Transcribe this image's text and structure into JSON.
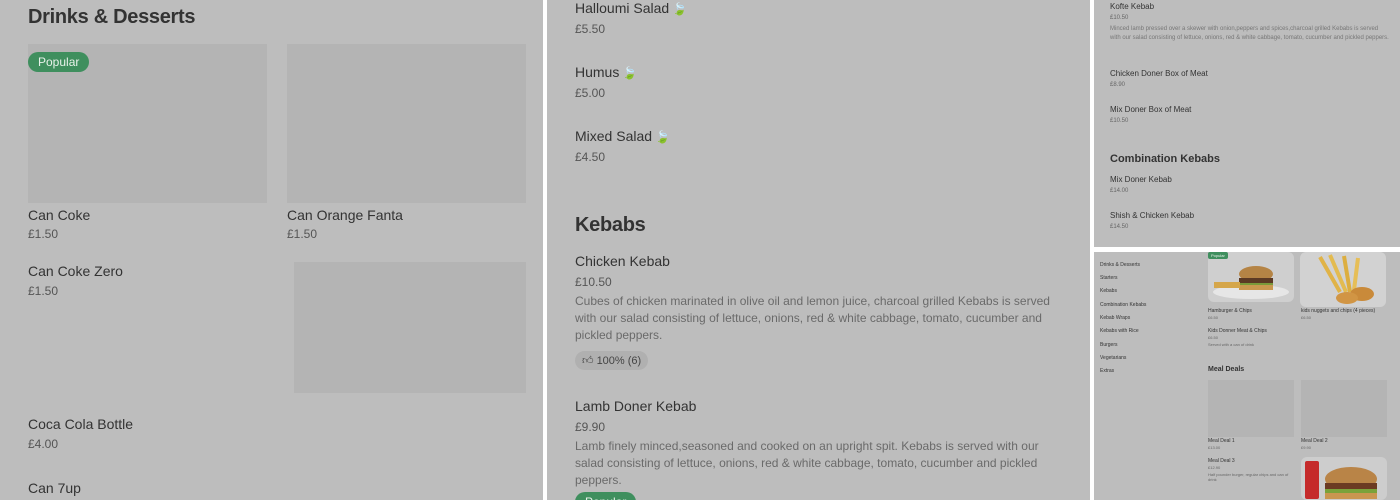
{
  "panel1": {
    "section_title": "Drinks & Desserts",
    "badge": "Popular",
    "items": [
      {
        "name": "Can Coke",
        "price": "£1.50"
      },
      {
        "name": "Can Orange Fanta",
        "price": "£1.50"
      },
      {
        "name": "Can Coke Zero",
        "price": "£1.50"
      },
      {
        "name": "Coca Cola Bottle",
        "price": "£4.00"
      },
      {
        "name": "Can 7up",
        "price": ""
      }
    ]
  },
  "panel2": {
    "salads": [
      {
        "name": "Halloumi Salad",
        "price": "£5.50"
      },
      {
        "name": "Humus",
        "price": "£5.00"
      },
      {
        "name": "Mixed Salad",
        "price": "£4.50"
      }
    ],
    "kebabs_title": "Kebabs",
    "kebabs": [
      {
        "name": "Chicken Kebab",
        "price": "£10.50",
        "desc": "Cubes of chicken marinated in olive oil and lemon juice, charcoal grilled Kebabs is served with our salad consisting of lettuce, onions, red & white cabbage, tomato, cucumber and pickled peppers.",
        "rating": "100% (6)"
      },
      {
        "name": "Lamb Doner Kebab",
        "price": "£9.90",
        "desc": "Lamb finely minced,seasoned and cooked on an upright spit. Kebabs is served with our salad consisting of lettuce, onions, red & white cabbage, tomato, cucumber and pickled peppers.",
        "badge": "Popular"
      }
    ]
  },
  "panel3": {
    "items": [
      {
        "name": "Kofte Kebab",
        "price": "£10.50",
        "desc": "Minced lamb pressed over a skewer with onion,peppers and spices,charcoal grilled Kebabs is served with our salad consisting of lettuce, onions, red & white cabbage, tomato, cucumber and pickled peppers."
      },
      {
        "name": "Chicken Doner Box of Meat",
        "price": "£8.90"
      },
      {
        "name": "Mix Doner Box of Meat",
        "price": "£10.50"
      }
    ],
    "combo_title": "Combination Kebabs",
    "combo": [
      {
        "name": "Mix Doner Kebab",
        "price": "£14.00"
      },
      {
        "name": "Shish & Chicken Kebab",
        "price": "£14.50"
      }
    ]
  },
  "panel4": {
    "nav": [
      "Drinks & Desserts",
      "Starters",
      "Kebabs",
      "Combination Kebabs",
      "Kebab Wraps",
      "Kebabs with Rice",
      "Burgers",
      "Vegetarians",
      "Extras"
    ],
    "badge": "Popular",
    "items": [
      {
        "name": "Hamburger & Chips",
        "price": "£6.50"
      },
      {
        "name": "kids nuggets and chips (4 pieces)",
        "price": "£6.50"
      },
      {
        "name": "Kids Donner Meat & Chips",
        "price": "£6.50",
        "desc": "Served with a can of drink"
      }
    ],
    "meal_title": "Meal Deals",
    "meals": [
      {
        "name": "Meal Deal 1",
        "price": "£13.00"
      },
      {
        "name": "Meal Deal 2",
        "price": "£9.90"
      },
      {
        "name": "Meal Deal 3",
        "price": "£12.90",
        "desc": "Half pounder burger, regular chips and can of drink"
      }
    ]
  },
  "colors": {
    "backdrop": "#bdbdbd",
    "tile": "#b4b4b4",
    "badge": "#3f8f5e"
  },
  "icons": {
    "leaf": "vegetarian-leaf-icon",
    "thumb": "thumbs-up-icon"
  }
}
